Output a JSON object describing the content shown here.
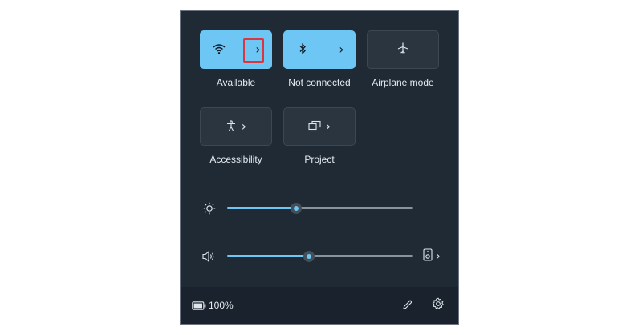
{
  "tiles": {
    "wifi": {
      "label": "Available",
      "icon": "wifi-icon",
      "state": "on"
    },
    "bluetooth": {
      "label": "Not connected",
      "icon": "bluetooth-icon",
      "state": "on"
    },
    "airplane": {
      "label": "Airplane mode",
      "icon": "airplane-icon",
      "state": "off"
    },
    "accessibility": {
      "label": "Accessibility",
      "icon": "accessibility-icon",
      "state": "off"
    },
    "project": {
      "label": "Project",
      "icon": "project-icon",
      "state": "off"
    }
  },
  "sliders": {
    "brightness": {
      "icon": "brightness-icon",
      "level": 0.37
    },
    "volume": {
      "icon": "volume-icon",
      "level": 0.44
    }
  },
  "footer": {
    "battery_text": "100%",
    "battery_icon": "battery-icon",
    "edit_icon": "pencil-icon",
    "settings_icon": "gear-icon"
  },
  "colors": {
    "panel_bg": "#1f2a35",
    "accent": "#6dc6f3",
    "highlight": "#d9363e"
  }
}
